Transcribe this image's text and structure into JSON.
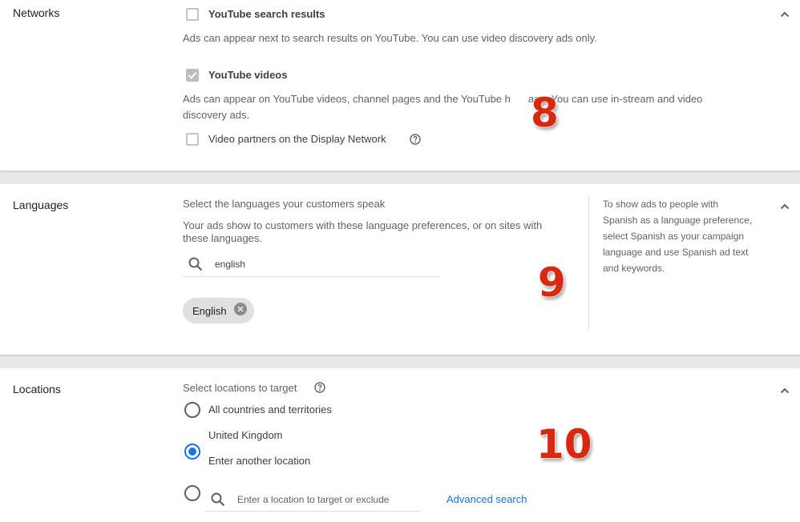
{
  "networks": {
    "title": "Networks",
    "youtube_search": {
      "label": "YouTube search results",
      "checked": false,
      "description": "Ads can appear next to search results on YouTube. You can use video discovery ads only."
    },
    "youtube_videos": {
      "label": "YouTube videos",
      "checked": true,
      "description_line1": "Ads can appear on YouTube videos, channel pages and the YouTube h",
      "description_line1b": "age. You can use in-stream and video",
      "description_line2": "discovery ads."
    },
    "video_partners": {
      "label": "Video partners on the Display Network",
      "checked": false
    },
    "step_number": "8"
  },
  "languages": {
    "title": "Languages",
    "prompt": "Select the languages your customers speak",
    "description_line1": "Your ads show to customers with these language preferences, or on sites with",
    "description_line2": "these languages.",
    "search_value": "english",
    "chips": [
      {
        "label": "English"
      }
    ],
    "side_note_lines": [
      "To show ads to people with",
      "Spanish as a language preference,",
      "select Spanish as your campaign",
      "language and use Spanish ad text",
      "and keywords."
    ],
    "step_number": "9"
  },
  "locations": {
    "title": "Locations",
    "prompt": "Select locations to target",
    "options": [
      {
        "label": "All countries and territories",
        "selected": false
      },
      {
        "label": "United Kingdom",
        "selected": true
      },
      {
        "label": "Enter another location",
        "selected": false
      }
    ],
    "search_placeholder": "Enter a location to target or exclude",
    "advanced_search_label": "Advanced search",
    "step_number": "10"
  },
  "colors": {
    "accent": "#1a73e8",
    "annotation": "#d8280f"
  }
}
